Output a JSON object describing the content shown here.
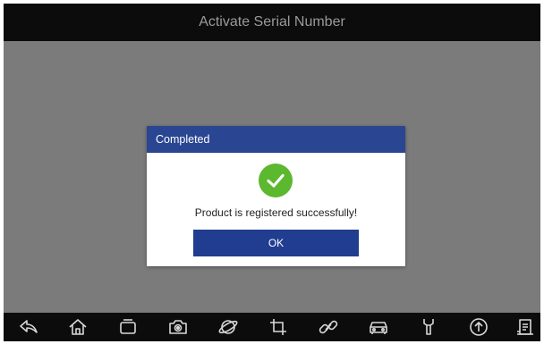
{
  "title_bar": {
    "title": "Activate Serial Number"
  },
  "dialog": {
    "header": "Completed",
    "message": "Product is registered successfully!",
    "ok_label": "OK",
    "status_icon": "check-circle-icon"
  },
  "nav_bar": {
    "icons": [
      "back-icon",
      "home-icon",
      "recent-apps-icon",
      "camera-icon",
      "browser-icon",
      "crop-icon",
      "link-icon",
      "car-icon",
      "repair-icon",
      "upload-icon",
      "document-icon"
    ]
  },
  "colors": {
    "title_bar_bg": "#0c0c0c",
    "dialog_header_bg": "#2a4591",
    "ok_button_bg": "#213d8f",
    "success_green": "#5cb82e",
    "overlay_gray": "#7b7b7b"
  }
}
